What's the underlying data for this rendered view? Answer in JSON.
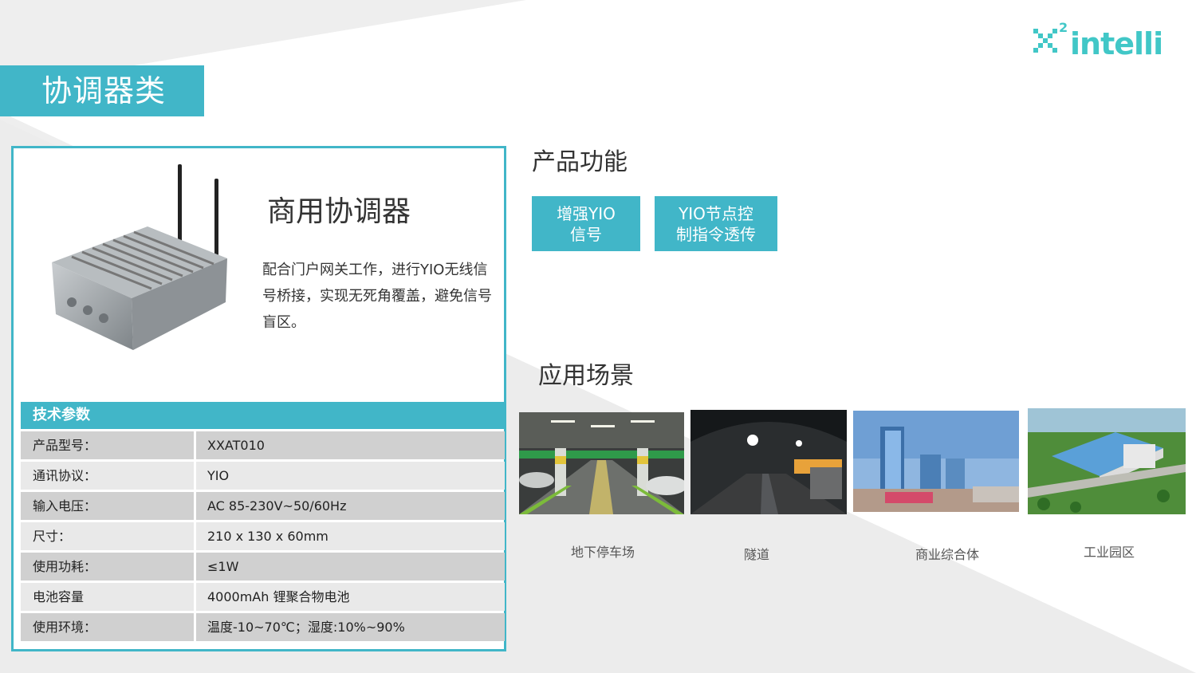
{
  "brand": {
    "logo_text": "X²intelli",
    "accent": "#41b6c8"
  },
  "section_title": "协调器类",
  "product": {
    "name": "商用协调器",
    "description": "配合门户网关工作，进行YIO无线信号桥接，实现无死角覆盖，避免信号盲区。"
  },
  "specs": {
    "header": "技术参数",
    "rows": [
      {
        "label": "产品型号：",
        "value": "XXAT010"
      },
      {
        "label": "通讯协议：",
        "value": "YIO"
      },
      {
        "label": "输入电压：",
        "value": "AC 85-230V~50/60Hz"
      },
      {
        "label": "尺寸：",
        "value": "210 x 130 x 60mm"
      },
      {
        "label": "使用功耗：",
        "value": "≤1W"
      },
      {
        "label": "电池容量",
        "value": "4000mAh 锂聚合物电池"
      },
      {
        "label": "使用环境：",
        "value": "温度-10~70℃；湿度:10%~90%"
      }
    ]
  },
  "functions": {
    "title": "产品功能",
    "items": [
      {
        "line1": "增强YIO",
        "line2": "信号"
      },
      {
        "line1": "YIO节点控",
        "line2": "制指令透传"
      }
    ]
  },
  "applications": {
    "title": "应用场景",
    "items": [
      {
        "label": "地下停车场",
        "icon": "parking-garage-photo"
      },
      {
        "label": "隧道",
        "icon": "tunnel-photo"
      },
      {
        "label": "商业综合体",
        "icon": "commercial-complex-photo"
      },
      {
        "label": "工业园区",
        "icon": "industrial-park-photo"
      }
    ]
  }
}
